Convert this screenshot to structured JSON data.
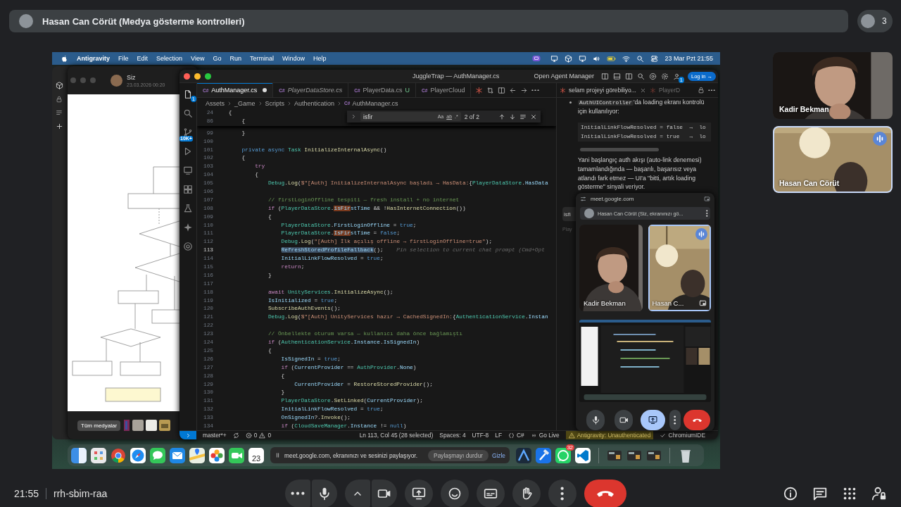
{
  "meeting_header": {
    "title": "Hasan Can Cörüt (Medya gösterme kontrolleri)",
    "participant_count": "3"
  },
  "shared_screen": {
    "menu_bar": {
      "app": "Antigravity",
      "items": [
        "File",
        "Edit",
        "Selection",
        "View",
        "Go",
        "Run",
        "Terminal",
        "Window",
        "Help"
      ],
      "clock": "23 Mar Pzt 21:55"
    },
    "photos_window": {
      "sender": "Siz",
      "date": "23.03.2026 00:20",
      "all_media_button": "Tüm medyalar"
    },
    "editor": {
      "title": "JuggleTrap — AuthManager.cs",
      "agent_manager": "Open Agent Manager",
      "login_button": "Log in →",
      "account_badge": "1",
      "explorer_badge": "1",
      "source_control_badge": "10K+",
      "tabs": [
        {
          "label": "AuthManager.cs",
          "file_icon": "C#",
          "selected": true,
          "preview": false,
          "modified": true
        },
        {
          "label": "PlayerDataStore.cs",
          "file_icon": "C#",
          "selected": false,
          "preview": true,
          "modified": false
        },
        {
          "label": "PlayerData.cs",
          "file_icon": "C#",
          "status": "U",
          "selected": false,
          "preview": false,
          "modified": false
        },
        {
          "label": "PlayerCloud",
          "file_icon": "C#",
          "selected": false,
          "preview": false,
          "modified": false
        }
      ],
      "breadcrumb": [
        "Assets",
        "_Game",
        "Scripts",
        "Authentication",
        "AuthManager.cs"
      ],
      "breadcrumb_file_icon": "C#",
      "find": {
        "query": "isfir",
        "match_case": "Aa",
        "whole_word": "ab",
        "regex": ".*",
        "result": "2 of 2"
      },
      "sticky_lines": [
        {
          "number": "24",
          "segments": [
            {
              "kind": "plain",
              "text": "    {"
            }
          ]
        },
        {
          "number": "86",
          "segments": [
            {
              "kind": "plain",
              "text": "        {"
            }
          ]
        }
      ],
      "lines": [
        {
          "number": "99",
          "current": false,
          "segments": [
            {
              "kind": "plain",
              "text": "        }"
            }
          ]
        },
        {
          "number": "100",
          "current": false
        },
        {
          "number": "101",
          "current": false,
          "segments": [
            {
              "kind": "keyword",
              "text": "        private async "
            },
            {
              "kind": "type",
              "text": "Task "
            },
            {
              "kind": "function",
              "text": "InitializeInternalAsync"
            },
            {
              "kind": "plain",
              "text": "()"
            }
          ]
        },
        {
          "number": "102",
          "current": false,
          "segments": [
            {
              "kind": "plain",
              "text": "        {"
            }
          ]
        },
        {
          "number": "103",
          "current": false,
          "segments": [
            {
              "kind": "control",
              "text": "            try"
            }
          ]
        },
        {
          "number": "104",
          "current": false,
          "segments": [
            {
              "kind": "plain",
              "text": "            {"
            }
          ]
        },
        {
          "number": "105",
          "current": false,
          "segments": [
            {
              "kind": "type",
              "text": "                Debug"
            },
            {
              "kind": "plain",
              "text": "."
            },
            {
              "kind": "function",
              "text": "Log"
            },
            {
              "kind": "plain",
              "text": "("
            },
            {
              "kind": "string",
              "text": "$\"[Auth] InitializeInternalAsync başladı → HasData:"
            },
            {
              "kind": "plain",
              "text": "{"
            },
            {
              "kind": "type",
              "text": "PlayerDataStore"
            },
            {
              "kind": "plain",
              "text": "."
            },
            {
              "kind": "variable",
              "text": "HasData"
            }
          ]
        },
        {
          "number": "106",
          "current": false
        },
        {
          "number": "107",
          "current": false,
          "segments": [
            {
              "kind": "comment",
              "text": "                // firstLoginOffline tespiti — fresh install + no internet"
            }
          ]
        },
        {
          "number": "108",
          "current": false,
          "segments": [
            {
              "kind": "control",
              "text": "                if"
            },
            {
              "kind": "plain",
              "text": " ("
            },
            {
              "kind": "type",
              "text": "PlayerDataStore"
            },
            {
              "kind": "plain",
              "text": "."
            },
            {
              "kind": "match",
              "text": "isFir"
            },
            {
              "kind": "variable",
              "text": "stTime"
            },
            {
              "kind": "plain",
              "text": " && !"
            },
            {
              "kind": "function",
              "text": "HasInternetConnection"
            },
            {
              "kind": "plain",
              "text": "())"
            }
          ]
        },
        {
          "number": "109",
          "current": false,
          "segments": [
            {
              "kind": "plain",
              "text": "                {"
            }
          ]
        },
        {
          "number": "110",
          "current": false,
          "segments": [
            {
              "kind": "type",
              "text": "                    PlayerDataStore"
            },
            {
              "kind": "plain",
              "text": "."
            },
            {
              "kind": "variable",
              "text": "FirstLoginOffline"
            },
            {
              "kind": "plain",
              "text": " = "
            },
            {
              "kind": "keyword",
              "text": "true"
            },
            {
              "kind": "plain",
              "text": ";"
            }
          ]
        },
        {
          "number": "111",
          "current": false,
          "segments": [
            {
              "kind": "type",
              "text": "                    PlayerDataStore"
            },
            {
              "kind": "plain",
              "text": "."
            },
            {
              "kind": "match",
              "text": "IsFir"
            },
            {
              "kind": "variable",
              "text": "stTime"
            },
            {
              "kind": "plain",
              "text": " = "
            },
            {
              "kind": "keyword",
              "text": "false"
            },
            {
              "kind": "plain",
              "text": ";"
            }
          ]
        },
        {
          "number": "112",
          "current": false,
          "segments": [
            {
              "kind": "type",
              "text": "                    Debug"
            },
            {
              "kind": "plain",
              "text": "."
            },
            {
              "kind": "function",
              "text": "Log"
            },
            {
              "kind": "plain",
              "text": "("
            },
            {
              "kind": "string",
              "text": "\"[Auth] İlk açılış offline → firstLoginOffline=true\""
            },
            {
              "kind": "plain",
              "text": ");"
            }
          ]
        },
        {
          "number": "113",
          "current": true,
          "segments": [
            {
              "kind": "selection",
              "text": "                    RefreshStoredProfileFallback"
            },
            {
              "kind": "plain",
              "text": "();"
            },
            {
              "kind": "hint",
              "text": "    Pin selection to current chat prompt (Cmd+Opt"
            }
          ]
        },
        {
          "number": "114",
          "current": false,
          "segments": [
            {
              "kind": "variable",
              "text": "                    InitialLinkFlowResolved"
            },
            {
              "kind": "plain",
              "text": " = "
            },
            {
              "kind": "keyword",
              "text": "true"
            },
            {
              "kind": "plain",
              "text": ";"
            }
          ]
        },
        {
          "number": "115",
          "current": false,
          "segments": [
            {
              "kind": "control",
              "text": "                    return"
            },
            {
              "kind": "plain",
              "text": ";"
            }
          ]
        },
        {
          "number": "116",
          "current": false,
          "segments": [
            {
              "kind": "plain",
              "text": "                }"
            }
          ]
        },
        {
          "number": "117",
          "current": false
        },
        {
          "number": "118",
          "current": false,
          "segments": [
            {
              "kind": "control",
              "text": "                await "
            },
            {
              "kind": "type",
              "text": "UnityServices"
            },
            {
              "kind": "plain",
              "text": "."
            },
            {
              "kind": "function",
              "text": "InitializeAsync"
            },
            {
              "kind": "plain",
              "text": "();"
            }
          ]
        },
        {
          "number": "119",
          "current": false,
          "segments": [
            {
              "kind": "variable",
              "text": "                IsInitialized"
            },
            {
              "kind": "plain",
              "text": " = "
            },
            {
              "kind": "keyword",
              "text": "true"
            },
            {
              "kind": "plain",
              "text": ";"
            }
          ]
        },
        {
          "number": "120",
          "current": false,
          "segments": [
            {
              "kind": "function",
              "text": "                SubscribeAuthEvents"
            },
            {
              "kind": "plain",
              "text": "();"
            }
          ]
        },
        {
          "number": "121",
          "current": false,
          "segments": [
            {
              "kind": "type",
              "text": "                Debug"
            },
            {
              "kind": "plain",
              "text": "."
            },
            {
              "kind": "function",
              "text": "Log"
            },
            {
              "kind": "plain",
              "text": "("
            },
            {
              "kind": "string",
              "text": "$\"[Auth] UnityServices hazır → CachedSignedIn:"
            },
            {
              "kind": "plain",
              "text": "{"
            },
            {
              "kind": "type",
              "text": "AuthenticationService"
            },
            {
              "kind": "plain",
              "text": "."
            },
            {
              "kind": "variable",
              "text": "Instan"
            }
          ]
        },
        {
          "number": "122",
          "current": false
        },
        {
          "number": "123",
          "current": false,
          "segments": [
            {
              "kind": "comment",
              "text": "                // Önbellekte oturum varsa — kullanıcı daha önce bağlamıştı"
            }
          ]
        },
        {
          "number": "124",
          "current": false,
          "segments": [
            {
              "kind": "control",
              "text": "                if"
            },
            {
              "kind": "plain",
              "text": " ("
            },
            {
              "kind": "type",
              "text": "AuthenticationService"
            },
            {
              "kind": "plain",
              "text": "."
            },
            {
              "kind": "variable",
              "text": "Instance"
            },
            {
              "kind": "plain",
              "text": "."
            },
            {
              "kind": "variable",
              "text": "IsSignedIn"
            },
            {
              "kind": "plain",
              "text": ")"
            }
          ]
        },
        {
          "number": "125",
          "current": false,
          "segments": [
            {
              "kind": "plain",
              "text": "                {"
            }
          ]
        },
        {
          "number": "126",
          "current": false,
          "segments": [
            {
              "kind": "variable",
              "text": "                    IsSignedIn"
            },
            {
              "kind": "plain",
              "text": " = "
            },
            {
              "kind": "keyword",
              "text": "true"
            },
            {
              "kind": "plain",
              "text": ";"
            }
          ]
        },
        {
          "number": "127",
          "current": false,
          "segments": [
            {
              "kind": "control",
              "text": "                    if"
            },
            {
              "kind": "plain",
              "text": " ("
            },
            {
              "kind": "variable",
              "text": "CurrentProvider"
            },
            {
              "kind": "plain",
              "text": " == "
            },
            {
              "kind": "type",
              "text": "AuthProvider"
            },
            {
              "kind": "plain",
              "text": "."
            },
            {
              "kind": "variable",
              "text": "None"
            },
            {
              "kind": "plain",
              "text": ")"
            }
          ]
        },
        {
          "number": "128",
          "current": false,
          "segments": [
            {
              "kind": "plain",
              "text": "                    {"
            }
          ]
        },
        {
          "number": "129",
          "current": false,
          "segments": [
            {
              "kind": "variable",
              "text": "                        CurrentProvider"
            },
            {
              "kind": "plain",
              "text": " = "
            },
            {
              "kind": "function",
              "text": "RestoreStoredProvider"
            },
            {
              "kind": "plain",
              "text": "();"
            }
          ]
        },
        {
          "number": "130",
          "current": false,
          "segments": [
            {
              "kind": "plain",
              "text": "                    }"
            }
          ]
        },
        {
          "number": "131",
          "current": false,
          "segments": [
            {
              "kind": "type",
              "text": "                    PlayerDataStore"
            },
            {
              "kind": "plain",
              "text": "."
            },
            {
              "kind": "function",
              "text": "SetLinked"
            },
            {
              "kind": "plain",
              "text": "("
            },
            {
              "kind": "variable",
              "text": "CurrentProvider"
            },
            {
              "kind": "plain",
              "text": ");"
            }
          ]
        },
        {
          "number": "132",
          "current": false,
          "segments": [
            {
              "kind": "variable",
              "text": "                    InitialLinkFlowResolved"
            },
            {
              "kind": "plain",
              "text": " = "
            },
            {
              "kind": "keyword",
              "text": "true"
            },
            {
              "kind": "plain",
              "text": ";"
            }
          ]
        },
        {
          "number": "133",
          "current": false,
          "segments": [
            {
              "kind": "variable",
              "text": "                    OnSignedIn"
            },
            {
              "kind": "plain",
              "text": "?."
            },
            {
              "kind": "function",
              "text": "Invoke"
            },
            {
              "kind": "plain",
              "text": "();"
            }
          ]
        },
        {
          "number": "134",
          "current": false,
          "segments": [
            {
              "kind": "control",
              "text": "                    if"
            },
            {
              "kind": "plain",
              "text": " ("
            },
            {
              "kind": "type",
              "text": "CloudSaveManager"
            },
            {
              "kind": "plain",
              "text": "."
            },
            {
              "kind": "variable",
              "text": "Instance"
            },
            {
              "kind": "plain",
              "text": " != "
            },
            {
              "kind": "keyword",
              "text": "null"
            },
            {
              "kind": "plain",
              "text": ")"
            }
          ]
        }
      ],
      "status_bar": {
        "branch": "master*+",
        "errors": "0",
        "warnings": "0",
        "items": [
          {
            "kind": "text",
            "text": "Ln 113, Col 45 (28 selected)"
          },
          {
            "kind": "text",
            "text": "Spaces: 4"
          },
          {
            "kind": "text",
            "text": "UTF-8"
          },
          {
            "kind": "text",
            "text": "LF"
          },
          {
            "kind": "language",
            "text": "C#"
          },
          {
            "kind": "live",
            "text": "Go Live"
          },
          {
            "kind": "warning",
            "text": "Antigravity: Unauthenticated"
          },
          {
            "kind": "check",
            "text": "ChromiumIDE"
          }
        ]
      }
    },
    "chat_panel": {
      "tabs": [
        {
          "label": "selam projeyi görebiliyo...",
          "selected": true
        },
        {
          "label": "PlayerD",
          "selected": false
        }
      ],
      "bullet": {
        "code": "AuthUIController",
        "text": "'da loading ekranı kontrolü için kullanılıyor:"
      },
      "code_block": [
        "InitialLinkFlowResolved = false  →  lo",
        "InitialLinkFlowResolved = true   →  lo"
      ],
      "paragraph": "Yani başlangıç auth akışı (auto-link denemesi) tamamlandığında — başarılı, başarısız veya atlandı fark etmez — UI'a \"bitti, artık loading gösterme\" sinyali veriyor.",
      "search_fragment": "isfi",
      "label_fragment": "Play"
    },
    "meet_pip": {
      "url": "meet.google.com",
      "presenter": "Hasan Can Cörüt (Siz, ekranınızı gö...",
      "tiles": [
        {
          "name": "Kadir Bekman",
          "speaking": false
        },
        {
          "name": "Hasan C...",
          "speaking": true
        }
      ]
    },
    "dock": {
      "calendar_day": "23",
      "whatsapp_badge": "32",
      "sharing_notice": {
        "text": "meet.google.com, ekranınızı ve sesinizi paylaşıyor.",
        "stop_button": "Paylaşmayı durdur",
        "hide_button": "Gizle"
      }
    }
  },
  "participants": [
    {
      "name": "Kadir Bekman",
      "speaking": false
    },
    {
      "name": "Hasan Can Cörüt",
      "speaking": true
    }
  ],
  "bottom_bar": {
    "time": "21:55",
    "meeting_code": "rrh-sbim-raa"
  }
}
